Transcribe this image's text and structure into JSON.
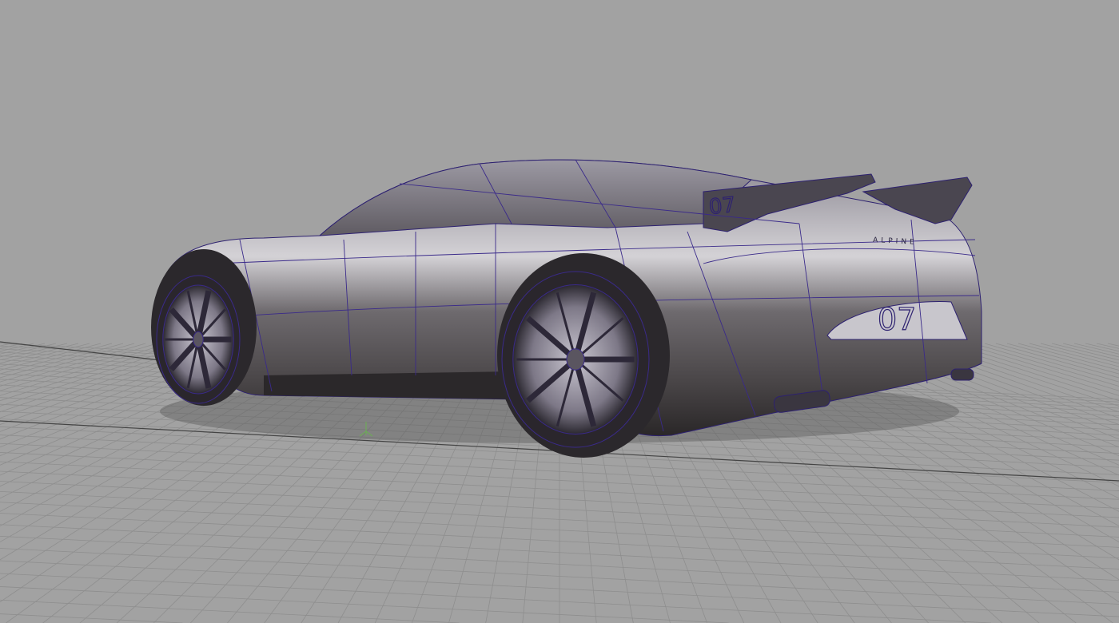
{
  "viewport": {
    "background_color": "#a2a2a2",
    "grid_color": "#8e8e8e",
    "wire_color": "#3a2a8a"
  },
  "model": {
    "brand_badge": "ALPINE",
    "rear_number": "07",
    "wing_number": "07"
  }
}
